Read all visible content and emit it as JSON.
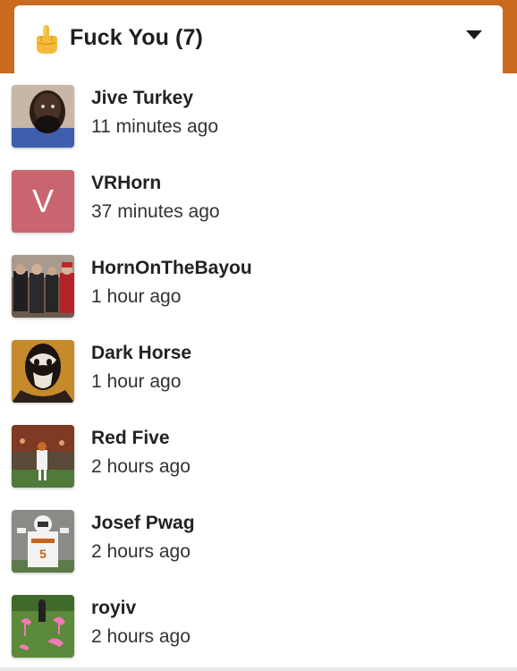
{
  "header": {
    "reaction_icon": "middle-finger-emoji",
    "title": "Fuck You (7)",
    "toggle_icon": "caret-down-icon"
  },
  "users": [
    {
      "name": "Jive Turkey",
      "time": "11 minutes ago",
      "avatar": "photo"
    },
    {
      "name": "VRHorn",
      "time": "37 minutes ago",
      "avatar": "letter",
      "letter": "V",
      "avatar_color": "#c8656e"
    },
    {
      "name": "HornOnTheBayou",
      "time": "1 hour ago",
      "avatar": "photo"
    },
    {
      "name": "Dark Horse",
      "time": "1 hour ago",
      "avatar": "photo"
    },
    {
      "name": "Red Five",
      "time": "2 hours ago",
      "avatar": "photo"
    },
    {
      "name": "Josef Pwag",
      "time": "2 hours ago",
      "avatar": "photo"
    },
    {
      "name": "royiv",
      "time": "2 hours ago",
      "avatar": "photo"
    }
  ],
  "colors": {
    "header_band": "#c96a1e",
    "text": "#222222"
  }
}
